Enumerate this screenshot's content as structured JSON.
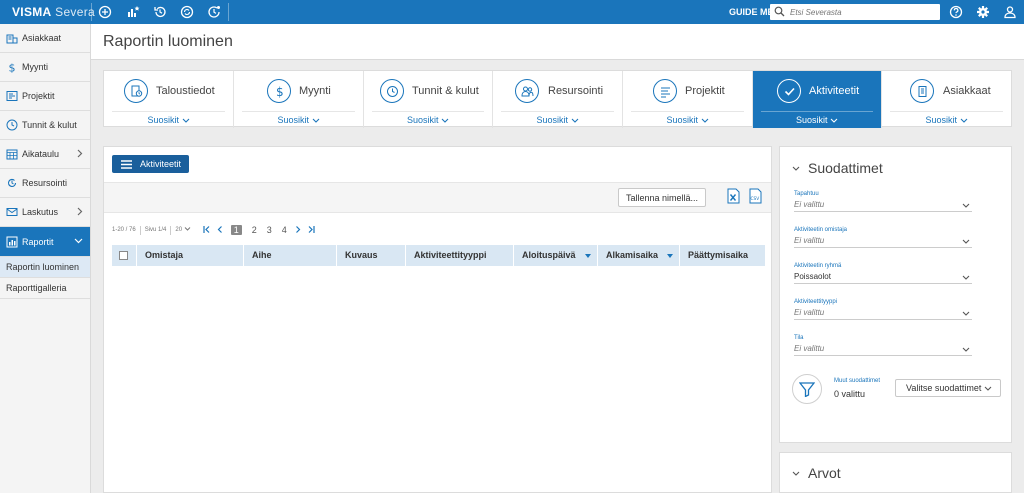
{
  "topbar": {
    "brand_strong": "VISMA",
    "brand_light": "Severa",
    "guide_me": "GUIDE ME",
    "search_placeholder": "Etsi Severasta",
    "icons": [
      "add-icon",
      "dashboard-star-icon",
      "history-icon",
      "refresh-icon",
      "activity-icon",
      "help-icon",
      "settings-icon",
      "user-icon"
    ],
    "color": "#1a75bb"
  },
  "sidebar": {
    "items": [
      {
        "label": "Asiakkaat",
        "icon": "customers-icon"
      },
      {
        "label": "Myynti",
        "icon": "dollar-icon"
      },
      {
        "label": "Projektit",
        "icon": "projects-icon"
      },
      {
        "label": "Tunnit & kulut",
        "icon": "clock-icon"
      },
      {
        "label": "Aikataulu",
        "icon": "calendar-icon",
        "has_children": true
      },
      {
        "label": "Resursointi",
        "icon": "resourcing-icon"
      },
      {
        "label": "Laskutus",
        "icon": "invoice-icon",
        "has_children": true
      },
      {
        "label": "Raportit",
        "icon": "reports-icon",
        "has_children": true,
        "active": true
      }
    ],
    "sub_items": [
      {
        "label": "Raportin luominen",
        "selected": true
      },
      {
        "label": "Raporttigalleria"
      }
    ]
  },
  "header": {
    "title": "Raportin luominen"
  },
  "categories": [
    {
      "label": "Taloustiedot",
      "fav": "Suosikit",
      "icon": "finance-icon"
    },
    {
      "label": "Myynti",
      "fav": "Suosikit",
      "icon": "dollar-icon"
    },
    {
      "label": "Tunnit & kulut",
      "fav": "Suosikit",
      "icon": "clock-icon"
    },
    {
      "label": "Resursointi",
      "fav": "Suosikit",
      "icon": "resourcing-icon"
    },
    {
      "label": "Projektit",
      "fav": "Suosikit",
      "icon": "projects-icon"
    },
    {
      "label": "Aktiviteetit",
      "fav": "Suosikit",
      "icon": "check-icon",
      "active": true
    },
    {
      "label": "Asiakkaat",
      "fav": "Suosikit",
      "icon": "customers-icon"
    }
  ],
  "main": {
    "view_button": "Aktiviteetit",
    "save_as": "Tallenna nimellä...",
    "export": [
      "excel-icon",
      "csv-icon"
    ],
    "csv_label": "CSV",
    "pager": {
      "range": "1-20 / 76",
      "page_of": "Sivu 1/4",
      "page_size": "20",
      "pages": [
        "1",
        "2",
        "3",
        "4"
      ],
      "current": "1"
    },
    "columns": [
      "Omistaja",
      "Aihe",
      "Kuvaus",
      "Aktiviteettityyppi",
      "Aloituspäivä",
      "Alkamisaika",
      "Päättymisaika"
    ]
  },
  "filters": {
    "title": "Suodattimet",
    "fields": [
      {
        "label": "Tapahtuu",
        "value": "Ei valittu",
        "placeholder": true
      },
      {
        "label": "Aktiviteetin omistaja",
        "value": "Ei valittu",
        "placeholder": true
      },
      {
        "label": "Aktiviteetin ryhmä",
        "value": "Poissaolot",
        "placeholder": false
      },
      {
        "label": "Aktiviteettityyppi",
        "value": "Ei valittu",
        "placeholder": true
      },
      {
        "label": "Tila",
        "value": "Ei valittu",
        "placeholder": true
      }
    ],
    "other_label": "Muut suodattimet",
    "other_value": "0 valittu",
    "choose_button": "Valitse suodattimet"
  },
  "values_section": {
    "title": "Arvot"
  }
}
